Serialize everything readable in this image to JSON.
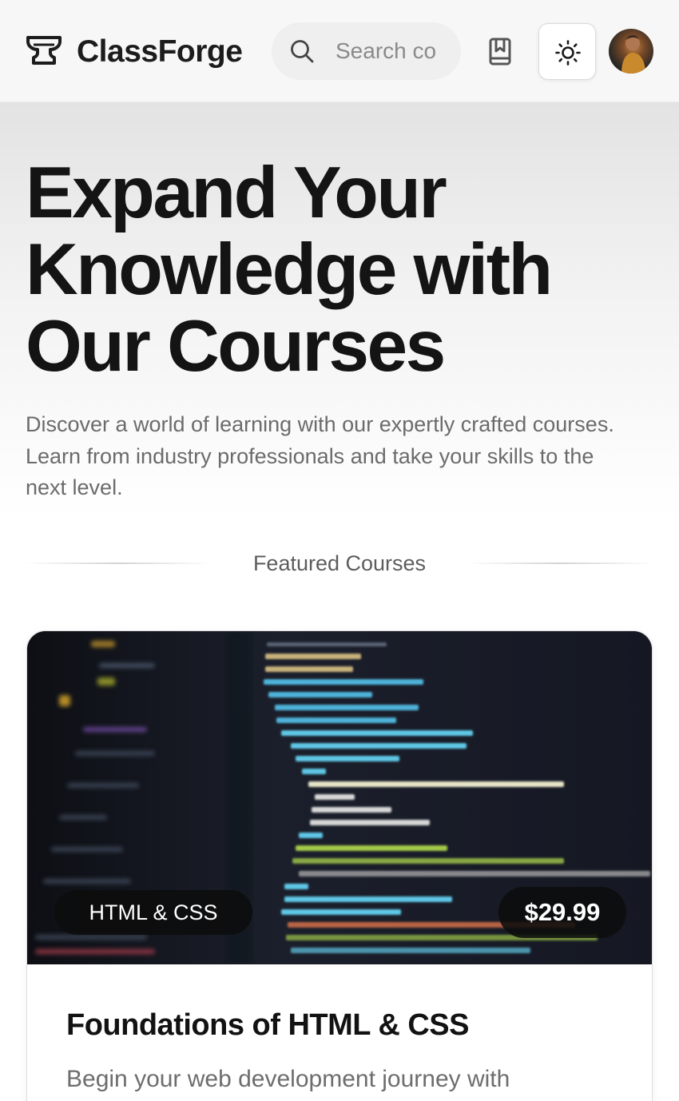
{
  "header": {
    "brand": "ClassForge",
    "search_placeholder": "Search co",
    "icons": {
      "logo": "anvil-icon",
      "search": "search-icon",
      "bookmark": "bookmark-book-icon",
      "theme": "sun-icon"
    }
  },
  "hero": {
    "title": "Expand Your Knowledge with Our Courses",
    "subtitle": "Discover a world of learning with our expertly crafted courses. Learn from industry professionals and take your skills to the next level."
  },
  "featured": {
    "label": "Featured Courses"
  },
  "courses": [
    {
      "category": "HTML & CSS",
      "price": "$29.99",
      "title": "Foundations of HTML & CSS",
      "description": "Begin your web development journey with"
    }
  ],
  "colors": {
    "header_bg": "#f7f7f7",
    "text": "#141414",
    "muted": "#6b6b6b",
    "pill_bg": "#0c0c0c"
  }
}
